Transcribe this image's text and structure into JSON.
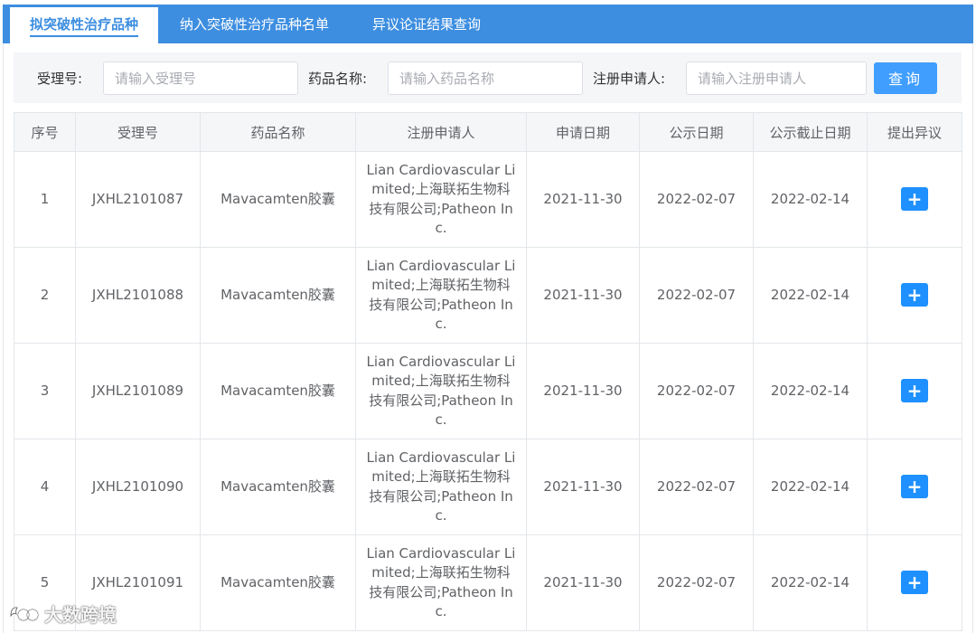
{
  "tabs": [
    {
      "label": "拟突破性治疗品种"
    },
    {
      "label": "纳入突破性治疗品种名单"
    },
    {
      "label": "异议论证结果查询"
    }
  ],
  "search": {
    "accept_label": "受理号:",
    "accept_placeholder": "请输入受理号",
    "drug_label": "药品名称:",
    "drug_placeholder": "请输入药品名称",
    "applicant_label": "注册申请人:",
    "applicant_placeholder": "请输入注册申请人",
    "query_button": "查询"
  },
  "table": {
    "headers": [
      "序号",
      "受理号",
      "药品名称",
      "注册申请人",
      "申请日期",
      "公示日期",
      "公示截止日期",
      "提出异议"
    ],
    "rows": [
      {
        "no": "1",
        "accept_no": "JXHL2101087",
        "drug": "Mavacamten胶囊",
        "applicant": "Lian Cardiovascular Limited;上海联拓生物科技有限公司;Patheon Inc.",
        "apply_date": "2021-11-30",
        "publish_date": "2022-02-07",
        "deadline": "2022-02-14",
        "action": "+"
      },
      {
        "no": "2",
        "accept_no": "JXHL2101088",
        "drug": "Mavacamten胶囊",
        "applicant": "Lian Cardiovascular Limited;上海联拓生物科技有限公司;Patheon Inc.",
        "apply_date": "2021-11-30",
        "publish_date": "2022-02-07",
        "deadline": "2022-02-14",
        "action": "+"
      },
      {
        "no": "3",
        "accept_no": "JXHL2101089",
        "drug": "Mavacamten胶囊",
        "applicant": "Lian Cardiovascular Limited;上海联拓生物科技有限公司;Patheon Inc.",
        "apply_date": "2021-11-30",
        "publish_date": "2022-02-07",
        "deadline": "2022-02-14",
        "action": "+"
      },
      {
        "no": "4",
        "accept_no": "JXHL2101090",
        "drug": "Mavacamten胶囊",
        "applicant": "Lian Cardiovascular Limited;上海联拓生物科技有限公司;Patheon Inc.",
        "apply_date": "2021-11-30",
        "publish_date": "2022-02-07",
        "deadline": "2022-02-14",
        "action": "+"
      },
      {
        "no": "5",
        "accept_no": "JXHL2101091",
        "drug": "Mavacamten胶囊",
        "applicant": "Lian Cardiovascular Limited;上海联拓生物科技有限公司;Patheon Inc.",
        "apply_date": "2021-11-30",
        "publish_date": "2022-02-07",
        "deadline": "2022-02-14",
        "action": "+"
      }
    ]
  },
  "watermark": {
    "text": "大数跨境"
  },
  "colors": {
    "accent": "#3d8ee0",
    "button": "#409eff",
    "plus": "#1e90ff",
    "header_bg": "#f4f6f8"
  }
}
